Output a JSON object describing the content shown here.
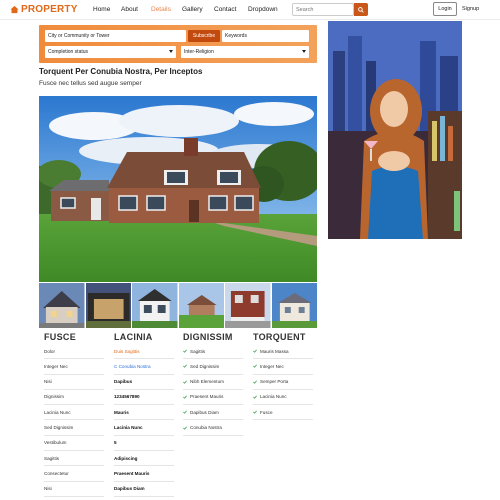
{
  "brand": {
    "name": "PROPERTY",
    "color": "#e06a1a",
    "icon": "home-icon"
  },
  "nav": {
    "items": [
      {
        "label": "Home",
        "active": false
      },
      {
        "label": "About",
        "active": false
      },
      {
        "label": "Details",
        "active": true
      },
      {
        "label": "Gallery",
        "active": false
      },
      {
        "label": "Contact",
        "active": false
      },
      {
        "label": "Dropdown",
        "active": false
      }
    ],
    "search_placeholder": "Search",
    "search_icon": "search-icon",
    "login_label": "Login",
    "signup_label": "Signup"
  },
  "search_panel": {
    "city_placeholder": "City or Community or Tower",
    "subscribe_label": "Subscribe",
    "keywords_placeholder": "Keywords",
    "status_selected": "Completion status",
    "religion_selected": "Inter-Religion"
  },
  "listing": {
    "title": "Torquent Per Conubia Nostra, Per Inceptos",
    "subtitle": "Fusce nec tellus sed augue semper"
  },
  "columns": {
    "fusce": {
      "heading": "FUSCE",
      "rows": [
        "Dolor",
        "Integer Nec",
        "Nisi",
        "Dignissim",
        "Lacinia Nunc",
        "Sed Dignissim",
        "Vestibulum",
        "Sagittis",
        "Consectetur",
        "Nisi"
      ]
    },
    "lacinia": {
      "heading": "LACINIA",
      "rows": [
        "Duis Sagittis",
        "C Conubia Nostra",
        "Dapibus",
        "1234567890",
        "Mauris",
        "Lacinia Nunc",
        "5",
        "Adipiscing",
        "Praesent Mauris",
        "Dapibus Diam"
      ]
    },
    "dignissim": {
      "heading": "DIGNISSIM",
      "rows": [
        "Sagittis",
        "Sed Dignissim",
        "Nibh Elementum",
        "Praesent Mauris",
        "Dapibus Diam",
        "Conubia Nostra"
      ]
    },
    "torquent": {
      "heading": "TORQUENT",
      "rows": [
        "Mauris Massa",
        "Integer Nec",
        "Semper Porta",
        "Lacinia Nunc",
        "Fusce"
      ]
    }
  },
  "colors": {
    "accent": "#e8844a",
    "panel": "#f08b3c",
    "button": "#c24a0e",
    "check": "#3aa04a"
  }
}
